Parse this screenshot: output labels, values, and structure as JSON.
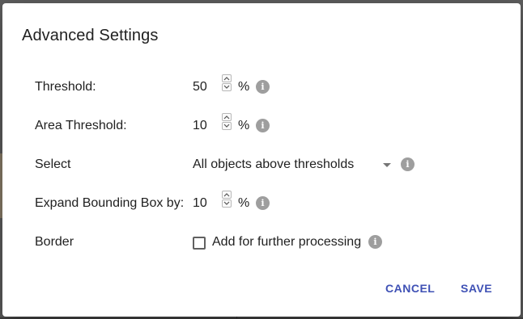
{
  "dialog": {
    "title": "Advanced Settings"
  },
  "fields": {
    "threshold": {
      "label": "Threshold:",
      "value": "50",
      "unit": "%"
    },
    "area_threshold": {
      "label": "Area Threshold:",
      "value": "10",
      "unit": "%"
    },
    "select": {
      "label": "Select",
      "value": "All objects above thresholds"
    },
    "expand_bbox": {
      "label": "Expand Bounding Box by:",
      "value": "10",
      "unit": "%"
    },
    "border": {
      "label": "Border",
      "checkbox_label": "Add for further processing",
      "checked": false
    }
  },
  "actions": {
    "cancel_label": "CANCEL",
    "save_label": "SAVE"
  },
  "icons": {
    "info": "info-icon",
    "spin_up": "chevron-up-icon",
    "spin_down": "chevron-down-icon",
    "dropdown": "triangle-down-icon"
  },
  "colors": {
    "accent": "#3f51b5",
    "info_icon": "#9e9e9e",
    "text": "#212121",
    "backdrop": "#5e5e5e"
  }
}
